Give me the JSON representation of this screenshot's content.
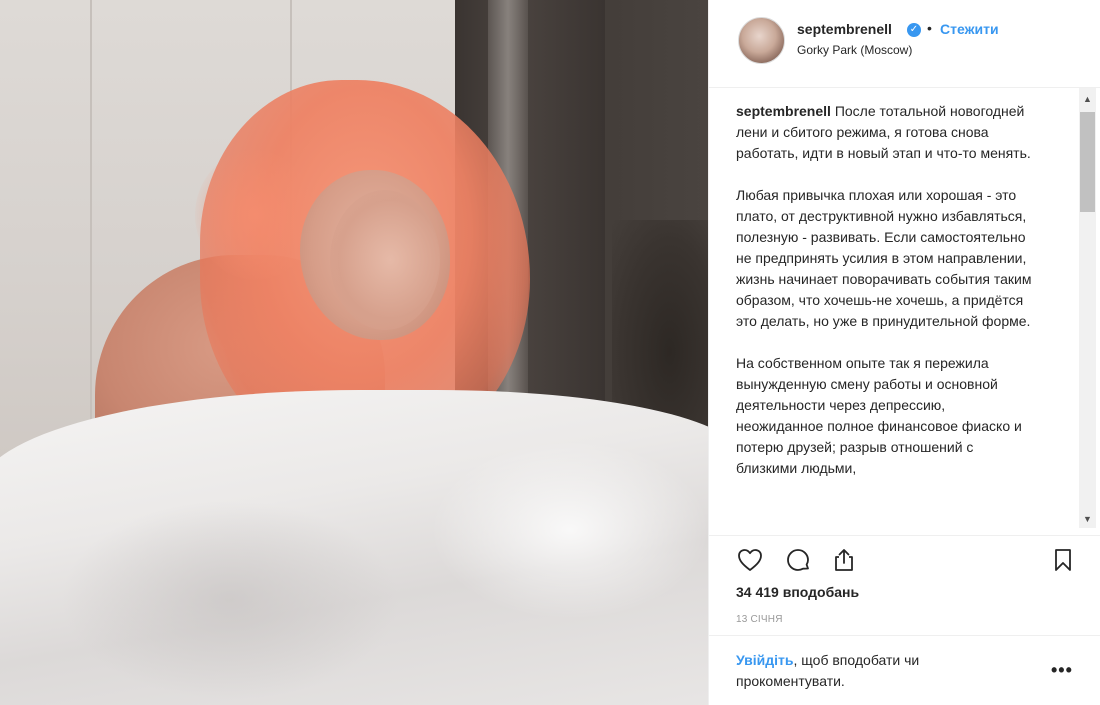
{
  "post": {
    "username": "septembrenell",
    "verified": true,
    "separator": "•",
    "follow_label": "Стежити",
    "location": "Gorky Park (Moscow)"
  },
  "caption": {
    "author": "septembrenell",
    "paragraphs": [
      "После тотальной новогодней лени и сбитого режима, я готова снова работать, идти в новый этап и что-то менять.",
      "Любая привычка плохая или хорошая - это плато, от деструктивной нужно избавляться, полезную - развивать. Если самостоятельно не предпринять усилия в этом направлении, жизнь начинает поворачивать события таким образом, что хочешь-не хочешь, а придётся это делать, но уже в принудительной форме.",
      "На собственном опыте так я пережила вынужденную смену работы и основной деятельности через депрессию, неожиданное полное финансовое фиаско и потерю друзей; разрыв отношений с близкими людьми,"
    ]
  },
  "actions": {
    "like_icon": "heart-icon",
    "comment_icon": "comment-icon",
    "share_icon": "share-icon",
    "save_icon": "bookmark-icon"
  },
  "stats": {
    "likes": "34 419 вподобань",
    "date": "13 СІЧНЯ"
  },
  "footer": {
    "login_link": "Увійдіть",
    "login_rest": ", щоб вподобати чи прокоментувати.",
    "more_label": "•••"
  },
  "scrollbar": {
    "up": "▲",
    "down": "▼"
  },
  "colors": {
    "link_blue": "#3897f0",
    "text": "#262626",
    "muted": "#999999"
  }
}
